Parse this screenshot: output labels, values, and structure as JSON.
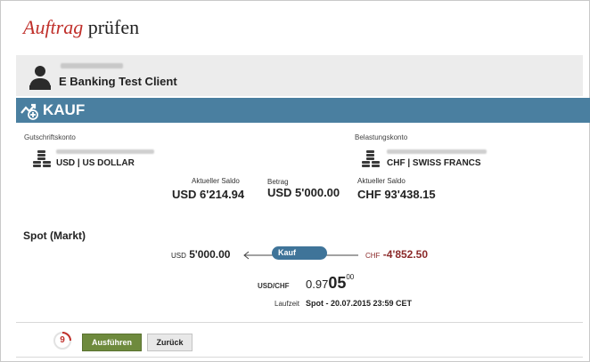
{
  "page": {
    "title_accent": "Auftrag",
    "title_rest": "prüfen"
  },
  "client": {
    "name": "E Banking Test Client"
  },
  "order": {
    "type": "KAUF"
  },
  "credit_account": {
    "label": "Gutschriftskonto",
    "currency": "USD | US DOLLAR",
    "balance_label": "Aktueller Saldo",
    "balance": "USD 6'214.94"
  },
  "amount": {
    "label": "Betrag",
    "value": "USD 5'000.00"
  },
  "debit_account": {
    "label": "Belastungskonto",
    "currency": "CHF | SWISS FRANCS",
    "balance_label": "Aktueller Saldo",
    "balance": "CHF 93'438.15"
  },
  "spot": {
    "title": "Spot (Markt)",
    "left_currency": "USD",
    "left_amount": "5'000.00",
    "direction_label": "Kauf",
    "right_currency": "CHF",
    "right_amount": "-4'852.50",
    "pair_label": "USD/CHF",
    "rate_part1": "0.97",
    "rate_part2": "05",
    "rate_part3": "00",
    "laufzeit_label": "Laufzeit",
    "laufzeit_value": "Spot - 20.07.2015 23:59 CET"
  },
  "actions": {
    "countdown": "9",
    "execute_label": "Ausführen",
    "back_label": "Zurück"
  },
  "colors": {
    "accent_red": "#c0302b",
    "band_blue": "#4a7fa0",
    "execute_green": "#6e8a3d",
    "negative_amount": "#8b2a2a"
  }
}
